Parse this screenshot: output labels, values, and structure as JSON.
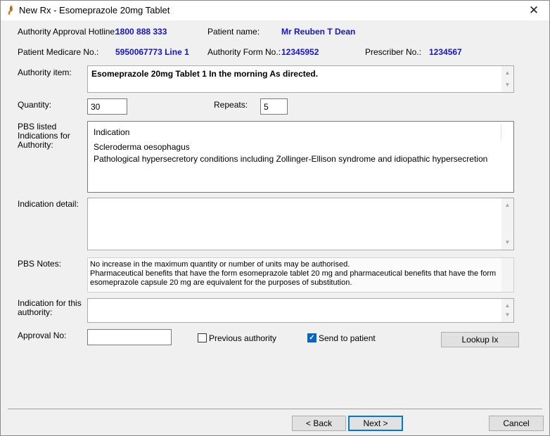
{
  "window": {
    "title": "New Rx - Esomeprazole  20mg Tablet"
  },
  "header": {
    "hotline_label": "Authority Approval Hotline:",
    "hotline_value": "1800 888 333",
    "patient_name_label": "Patient name:",
    "patient_name_value": "Mr Reuben T Dean",
    "medicare_label": "Patient Medicare No.:",
    "medicare_value": "5950067773 Line 1",
    "authority_form_label": "Authority Form No.:",
    "authority_form_value": "12345952",
    "prescriber_label": "Prescriber No.:",
    "prescriber_value": "1234567"
  },
  "authority_item": {
    "label": "Authority item:",
    "value": "Esomeprazole 20mg Tablet 1 In the morning As directed."
  },
  "quantity": {
    "label": "Quantity:",
    "value": "30"
  },
  "repeats": {
    "label": "Repeats:",
    "value": "5"
  },
  "indications": {
    "label": "PBS listed Indications for Authority:",
    "column_header": "Indication",
    "rows": [
      "Scleroderma oesophagus",
      "Pathological hypersecretory conditions including Zollinger-Ellison syndrome and idiopathic hypersecretion"
    ]
  },
  "indication_detail": {
    "label": "Indication detail:",
    "value": ""
  },
  "pbs_notes": {
    "label": "PBS Notes:",
    "lines": [
      "No increase in the maximum quantity or number of units may be authorised.",
      "Pharmaceutical benefits that have the form esomeprazole tablet 20 mg and pharmaceutical benefits that have the form",
      "esomeprazole capsule 20 mg are equivalent for the purposes of substitution."
    ]
  },
  "indication_for_authority": {
    "label": "Indication for this authority:",
    "value": ""
  },
  "approval_no": {
    "label": "Approval No:",
    "value": ""
  },
  "previous_authority": {
    "label": "Previous authority",
    "checked": false
  },
  "send_to_patient": {
    "label": "Send to patient",
    "checked": true
  },
  "buttons": {
    "lookup": "Lookup Ix",
    "back": "< Back",
    "next": "Next >",
    "cancel": "Cancel"
  },
  "colors": {
    "value_text": "#1515c8",
    "focus_border": "#0078d7",
    "check_fill": "#0a64c8"
  }
}
